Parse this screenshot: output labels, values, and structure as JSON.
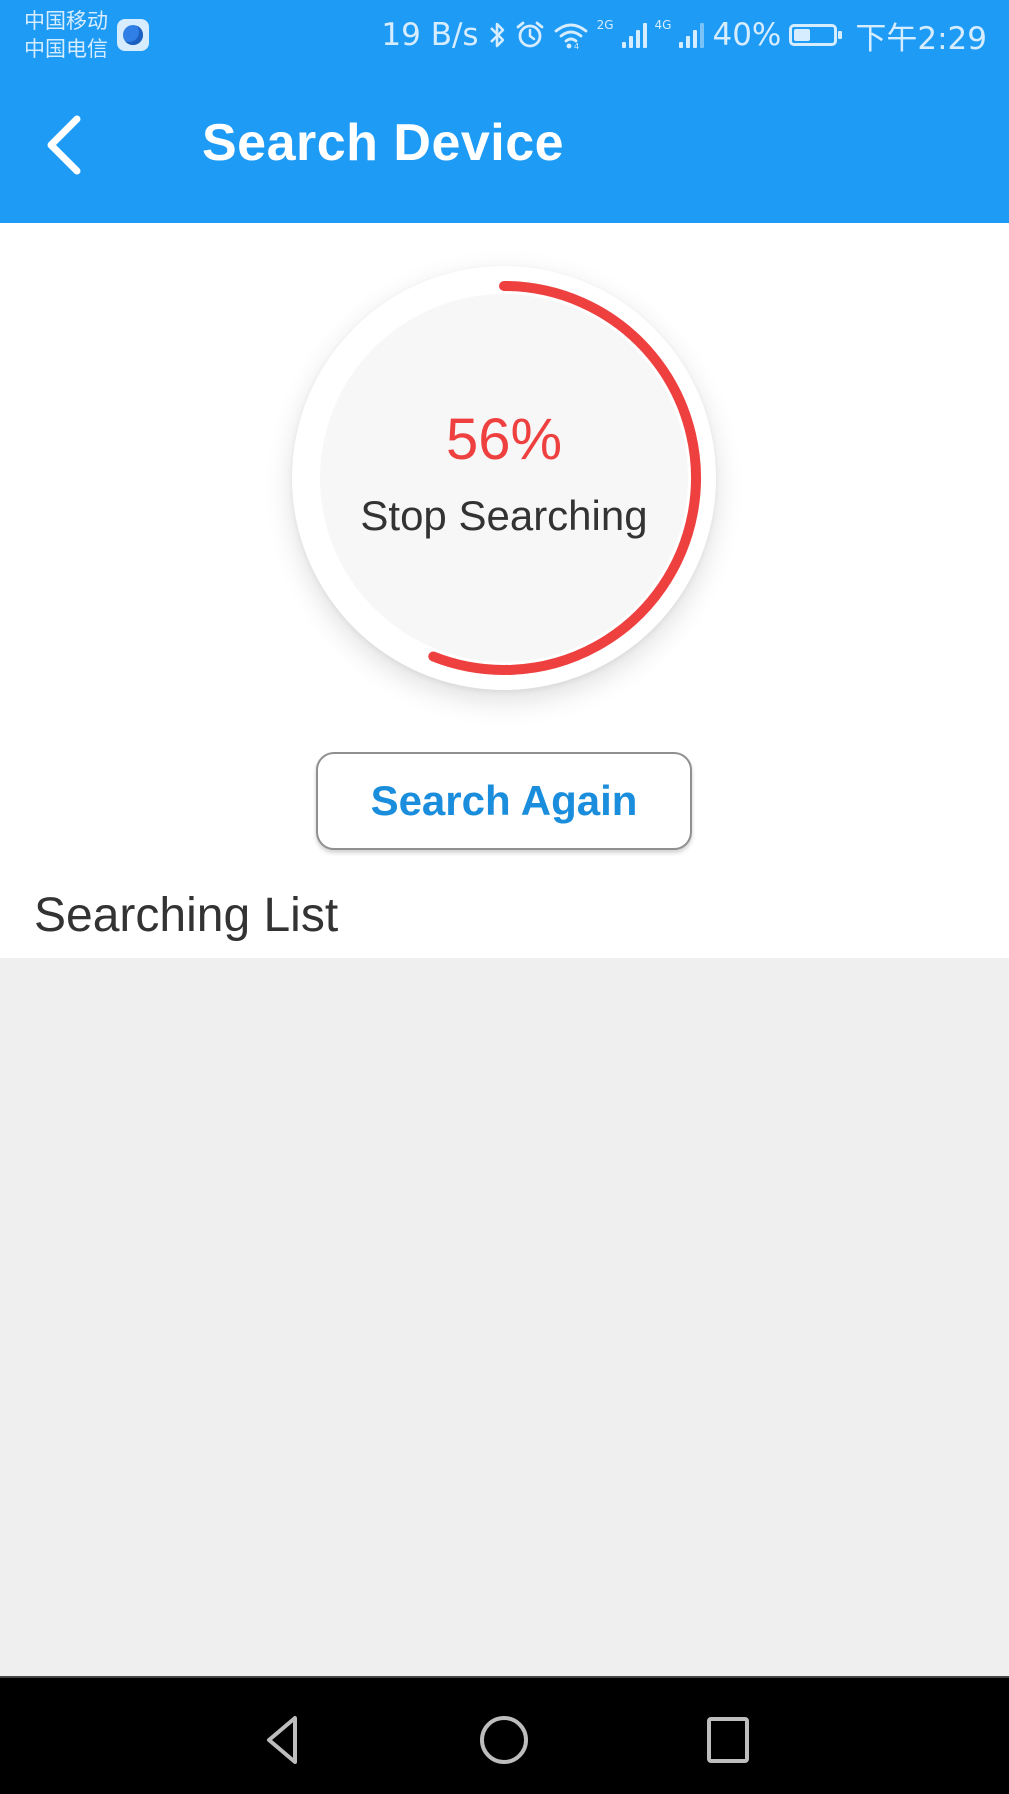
{
  "status_bar": {
    "carriers": [
      "中国移动",
      "中国电信"
    ],
    "carrier_app_icon": "app-notification-icon",
    "network_speed": "19 B/s",
    "icons": [
      "bluetooth-icon",
      "alarm-icon",
      "wifi-icon",
      "signal-2g-icon",
      "signal-4g-icon"
    ],
    "signal_labels": [
      "2G",
      "4G"
    ],
    "battery_percent": "40%",
    "battery_level": 0.4,
    "time": "下午2:29"
  },
  "header": {
    "back_icon": "chevron-left-icon",
    "title": "Search Device",
    "background_color": "#1E9BF5"
  },
  "progress": {
    "value": 0.56,
    "value_label": "56%",
    "action_label": "Stop Searching",
    "arc_color": "#EF4040"
  },
  "search_again": {
    "label": "Search Again",
    "text_color": "#1A8DDC"
  },
  "searching_list": {
    "title": "Searching List",
    "items": []
  },
  "nav_bar": {
    "buttons": [
      "back-triangle-icon",
      "home-circle-icon",
      "recents-square-icon"
    ]
  }
}
